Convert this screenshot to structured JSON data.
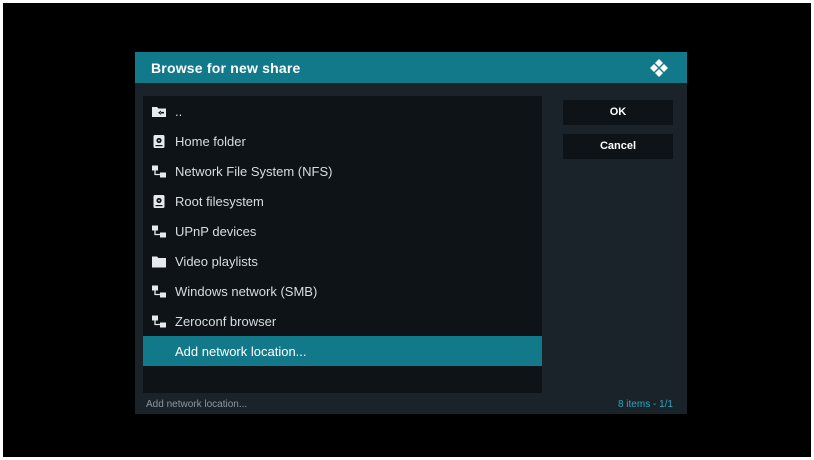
{
  "dialog": {
    "title": "Browse for new share",
    "logo_icon": "kodi-logo-icon"
  },
  "list": {
    "items": [
      {
        "label": "..",
        "icon": "folder-back-icon"
      },
      {
        "label": "Home folder",
        "icon": "drive-icon"
      },
      {
        "label": "Network File System (NFS)",
        "icon": "network-icon"
      },
      {
        "label": "Root filesystem",
        "icon": "drive-icon"
      },
      {
        "label": "UPnP devices",
        "icon": "network-icon"
      },
      {
        "label": "Video playlists",
        "icon": "folder-icon"
      },
      {
        "label": "Windows network (SMB)",
        "icon": "network-icon"
      },
      {
        "label": "Zeroconf browser",
        "icon": "network-icon"
      },
      {
        "label": "Add network location...",
        "icon": "none",
        "selected": true
      }
    ]
  },
  "buttons": {
    "ok_label": "OK",
    "cancel_label": "Cancel"
  },
  "footer": {
    "selected_text": "Add network location...",
    "items_count": "8 items - 1/1"
  },
  "colors": {
    "accent": "#12798a",
    "panel": "#1a2329",
    "list_bg": "#0e1317",
    "count_text": "#2aa6c0"
  }
}
